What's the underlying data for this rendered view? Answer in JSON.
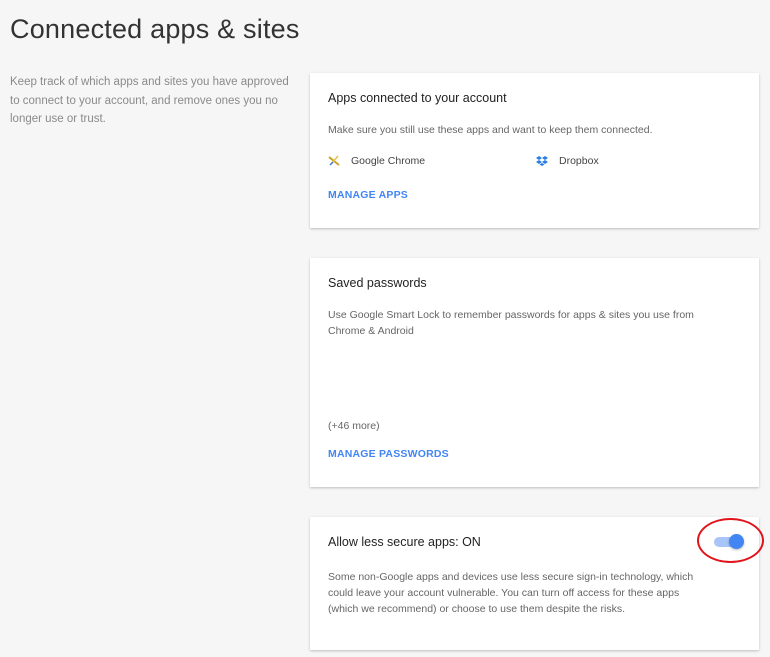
{
  "page": {
    "title": "Connected apps & sites",
    "intro": "Keep track of which apps and sites you have approved to connect to your account, and remove ones you no longer use or trust."
  },
  "apps_card": {
    "title": "Apps connected to your account",
    "description": "Make sure you still use these apps and want to keep them connected.",
    "apps": [
      {
        "name": "Google Chrome",
        "icon": "google-chrome-icon"
      },
      {
        "name": "Dropbox",
        "icon": "dropbox-icon"
      }
    ],
    "action_label": "MANAGE APPS"
  },
  "passwords_card": {
    "title": "Saved passwords",
    "description": "Use Google Smart Lock to remember passwords for apps & sites you use from Chrome & Android",
    "more_count": "(+46 more)",
    "action_label": "MANAGE PASSWORDS"
  },
  "less_secure_card": {
    "title": "Allow less secure apps: ON",
    "toggle_state": "on",
    "description": "Some non-Google apps and devices use less secure sign-in technology, which could leave your account vulnerable. You can turn off access for these apps (which we recommend) or choose to use them despite the risks."
  },
  "colors": {
    "accent": "#4285f4",
    "toggle_track": "#a8c4f8",
    "annotation": "#e0141a",
    "background": "#f6f6f6"
  }
}
